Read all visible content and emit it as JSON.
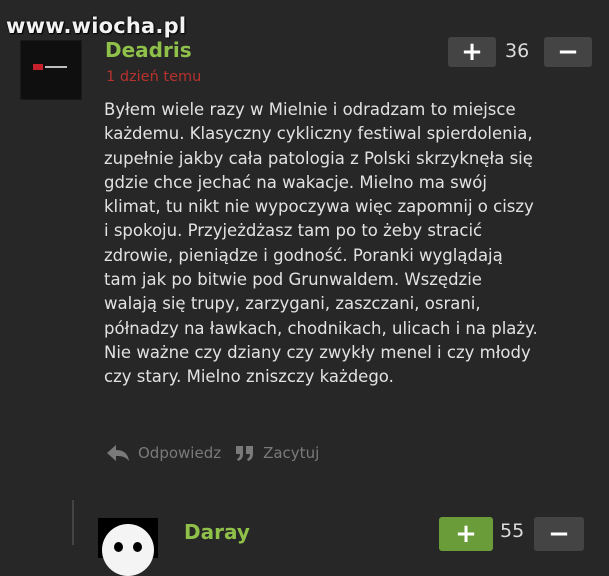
{
  "watermark": "www.wiocha.pl",
  "comment": {
    "username": "Deadris",
    "timestamp": "1 dzień temu",
    "score": "36",
    "upvote_label": "+",
    "downvote_label": "−",
    "body": "Byłem wiele razy w Mielnie i odradzam to miejsce\nkażdemu. Klasyczny cykliczny festiwal spierdolenia,\nzupełnie jakby cała patologia z Polski skrzyknęła się\ngdzie chce jechać na wakacje. Mielno ma swój\nklimat, tu nikt nie wypoczywa więc zapomnij o ciszy\ni spokoju. Przyjeżdżasz tam po to żeby stracić\nzdrowie, pieniądze i godność. Poranki wyglądają\ntam jak po bitwie pod Grunwaldem. Wszędzie\nwalają się trupy, zarzygani, zaszczani, osrani,\npółnadzy na ławkach, chodnikach, ulicach i na plaży.\nNie ważne czy dziany czy zwykły menel i czy młody\nczy stary. Mielno zniszczy każdego.",
    "reply_label": "Odpowiedz",
    "quote_label": "Zacytuj",
    "icons": {
      "reply": "reply-arrow-icon",
      "quote": "quote-icon"
    }
  },
  "reply": {
    "username": "Daray",
    "score": "55",
    "upvote_label": "+",
    "downvote_label": "−"
  },
  "colors": {
    "background": "#272727",
    "username": "#8fc14a",
    "timestamp": "#b8322e",
    "upvote_active": "#6a9c3a",
    "button": "#444444"
  }
}
